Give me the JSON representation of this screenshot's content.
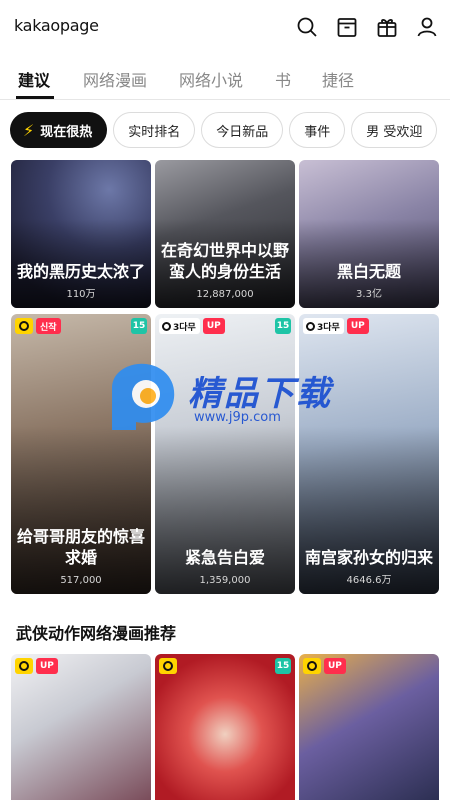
{
  "app": {
    "logo": "kakaopage"
  },
  "tabs": [
    {
      "label": "建议",
      "active": true
    },
    {
      "label": "网络漫画",
      "active": false
    },
    {
      "label": "网络小说",
      "active": false
    },
    {
      "label": "书",
      "active": false
    },
    {
      "label": "捷径",
      "active": false
    }
  ],
  "chips": [
    {
      "label": "现在很热",
      "active": true,
      "icon": "bolt-icon"
    },
    {
      "label": "实时排名"
    },
    {
      "label": "今日新品"
    },
    {
      "label": "事件"
    },
    {
      "label": "男 受欢迎"
    }
  ],
  "cards_row1": [
    {
      "title": "我的黑历史太浓了",
      "meta": "110万"
    },
    {
      "title": "在奇幻世界中以野蛮人的身份生活",
      "meta": "12,887,000"
    },
    {
      "title": "黑白无题",
      "meta": "3.3亿"
    }
  ],
  "cards_row2": [
    {
      "title": "给哥哥朋友的惊喜求婚",
      "meta": "517,000",
      "badges": {
        "clock": true,
        "new": "신작",
        "age": "15"
      }
    },
    {
      "title": "紧急告白爱",
      "meta": "1,359,000",
      "badges": {
        "wait": "3다무",
        "up": "UP",
        "age": "15"
      }
    },
    {
      "title": "南宫家孙女的归来",
      "meta": "4646.6万",
      "badges": {
        "wait": "3다무",
        "up": "UP"
      }
    }
  ],
  "section": {
    "title": "武侠动作网络漫画推荐"
  },
  "cards_row3": [
    {
      "badges": {
        "clock": true,
        "up": "UP"
      }
    },
    {
      "badges": {
        "clock": true,
        "age": "15"
      }
    },
    {
      "badges": {
        "clock": true,
        "up": "UP"
      }
    }
  ],
  "watermark": {
    "text": "精品下载",
    "url": "www.j9p.com"
  },
  "colors": {
    "accent_yellow": "#ffd400",
    "badge_red": "#ff2e4d",
    "age_green": "#1ec4a6"
  }
}
